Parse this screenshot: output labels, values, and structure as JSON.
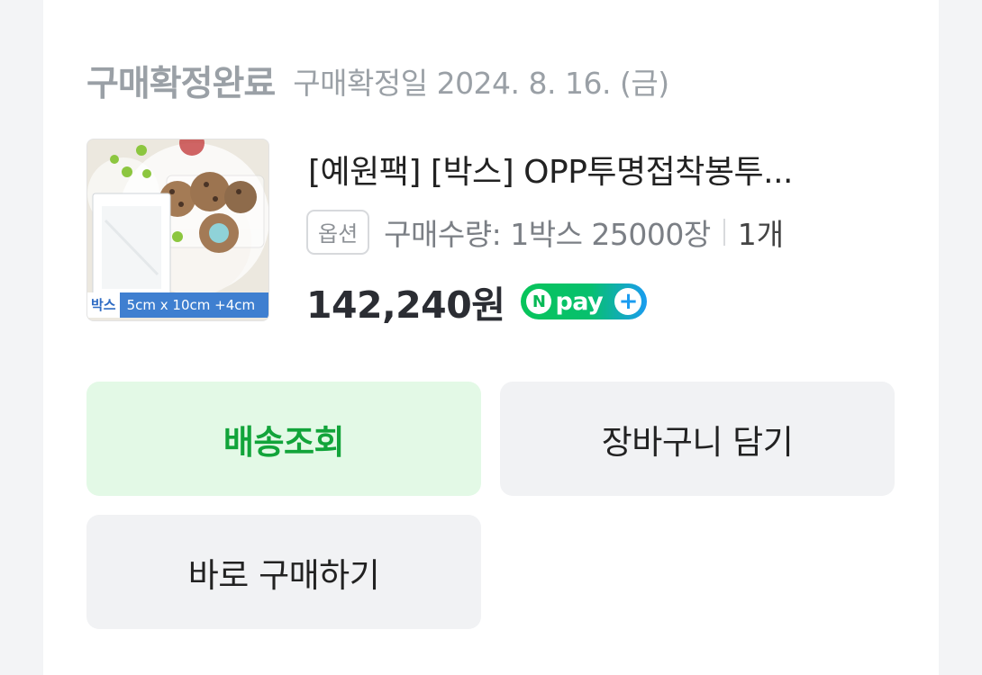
{
  "order": {
    "status_title": "구매확정완료",
    "confirm_date": "구매확정일 2024. 8. 16. (금)"
  },
  "product": {
    "thumbnail": {
      "badge": "박스",
      "size": "5cm x 10cm +4cm"
    },
    "title": "[예원팩] [박스] OPP투명접착봉투...",
    "option_badge": "옵션",
    "option_text": "구매수량: 1박스 25000장",
    "quantity": "1개",
    "price": "142,240원",
    "pay_badge": {
      "n_letter": "N",
      "text": "pay",
      "plus": "+",
      "icon": "npay-plus-logo"
    }
  },
  "actions": {
    "track_label": "배송조회",
    "cart_label": "장바구니 담기",
    "buy_label": "바로 구매하기"
  },
  "colors": {
    "accent_green": "#12a43a",
    "accent_green_bg": "#e3f9e6",
    "button_gray_bg": "#f1f2f4",
    "muted_text": "#9aa0a6"
  }
}
